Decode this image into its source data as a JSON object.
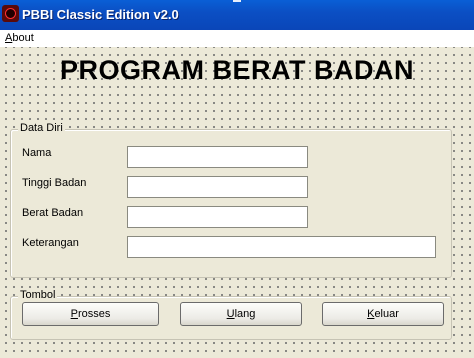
{
  "window": {
    "title": "PBBI Classic Edition v2.0",
    "icon": "app-logo-icon"
  },
  "menu": {
    "items": [
      "About"
    ]
  },
  "heading": "PROGRAM BERAT BADAN",
  "data_diri": {
    "group_label": "Data Diri",
    "fields": [
      {
        "label": "Nama",
        "value": ""
      },
      {
        "label": "Tinggi Badan",
        "value": ""
      },
      {
        "label": "Berat Badan",
        "value": ""
      },
      {
        "label": "Keterangan",
        "value": ""
      }
    ]
  },
  "tombol": {
    "group_label": "Tombol",
    "buttons": [
      {
        "first": "P",
        "rest": "rosses"
      },
      {
        "first": "U",
        "rest": "lang"
      },
      {
        "first": "K",
        "rest": "eluar"
      }
    ]
  },
  "colors": {
    "titlebar": "#0a50c8",
    "form_bg": "#ece9d8"
  }
}
